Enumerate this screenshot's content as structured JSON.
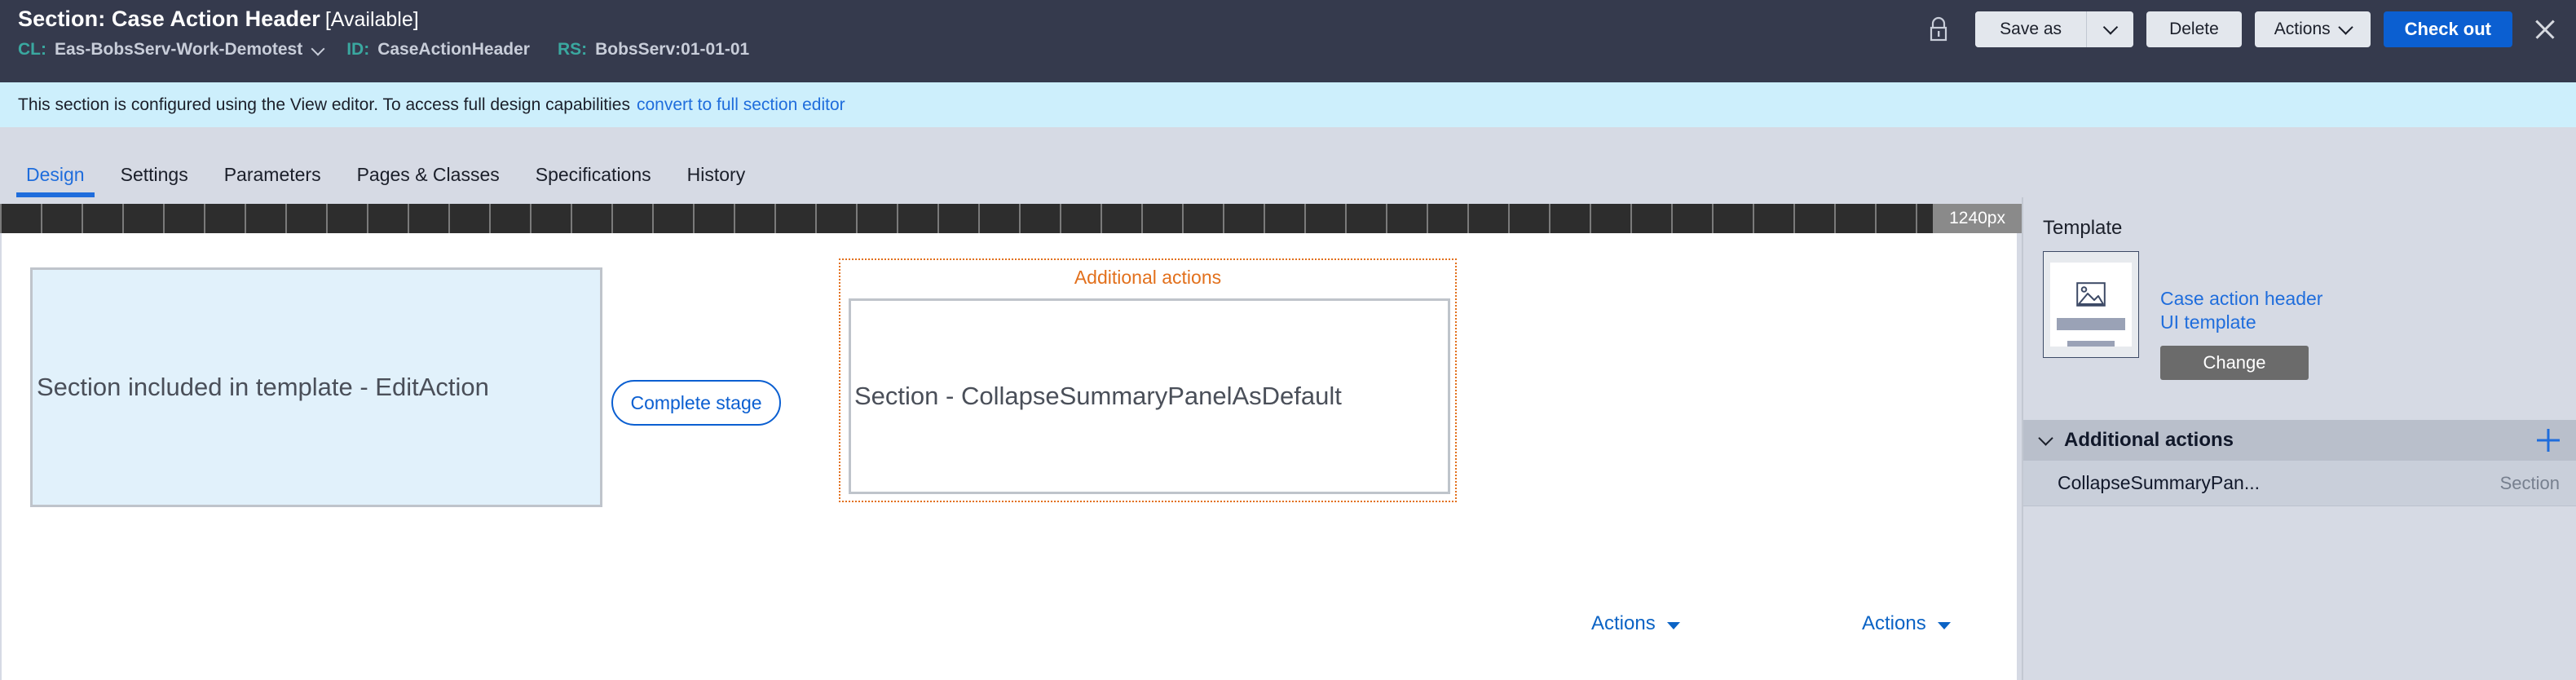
{
  "header": {
    "title_prefix": "Section: Case Action Header",
    "title_status": "[Available]",
    "meta": {
      "cl_key": "CL:",
      "cl_value": "Eas-BobsServ-Work-Demotest",
      "id_key": "ID:",
      "id_value": "CaseActionHeader",
      "rs_key": "RS:",
      "rs_value": "BobsServ:01-01-01"
    },
    "lock_icon": "lock-icon",
    "save_as_label": "Save as",
    "save_as_caret": "chevron-down-icon",
    "delete_label": "Delete",
    "actions_label": "Actions",
    "actions_caret": "chevron-down-icon",
    "check_out_label": "Check out",
    "close_icon": "close-icon",
    "bg_color": "#353a4d",
    "primary_color": "#0b5fd1",
    "accent_teal": "#3aa8a0"
  },
  "banner": {
    "text": "This section is configured using the View editor. To access full design capabilities",
    "link": "convert to full section editor",
    "bg_color": "#cdeffc",
    "link_color": "#1f6ddc"
  },
  "tabs": [
    {
      "label": "Design",
      "active": true
    },
    {
      "label": "Settings",
      "active": false
    },
    {
      "label": "Parameters",
      "active": false
    },
    {
      "label": "Pages & Classes",
      "active": false
    },
    {
      "label": "Specifications",
      "active": false
    },
    {
      "label": "History",
      "active": false
    }
  ],
  "canvas": {
    "ruler_badge": "1240px",
    "included_section_label": "Section included in template - EditAction",
    "stage_button_label": "Complete stage",
    "additional_actions_region_title": "Additional actions",
    "additional_actions_section_label": "Section - CollapseSummaryPanelAsDefault",
    "actions_dropdown_1": "Actions",
    "actions_dropdown_2": "Actions",
    "region_outline_color": "#e2701c",
    "included_fill_color": "#e1f1fb"
  },
  "sidebar": {
    "template_label": "Template",
    "template_thumb_icon": "image-placeholder-icon",
    "template_link": "Case action header UI template",
    "change_button_label": "Change",
    "group": {
      "collapse_icon": "chevron-down-icon",
      "title": "Additional actions",
      "add_icon": "plus-icon"
    },
    "rows": [
      {
        "name": "CollapseSummaryPan...",
        "type": "Section"
      }
    ]
  }
}
